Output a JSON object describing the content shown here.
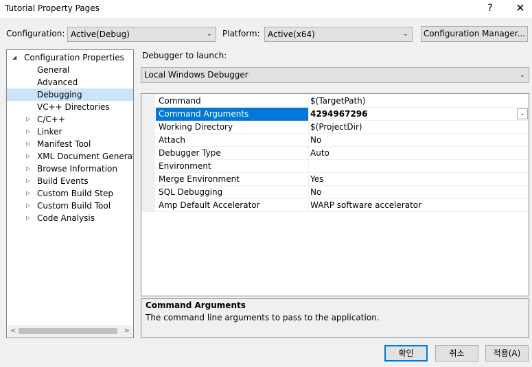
{
  "window": {
    "title": "Tutorial Property Pages",
    "help_glyph": "?",
    "close_glyph": "✕"
  },
  "toolbar": {
    "configuration_label": "Configuration:",
    "configuration_value": "Active(Debug)",
    "platform_label": "Platform:",
    "platform_value": "Active(x64)",
    "config_manager_label": "Configuration Manager..."
  },
  "tree": {
    "root": "Configuration Properties",
    "items": [
      {
        "label": "General",
        "expandable": false
      },
      {
        "label": "Advanced",
        "expandable": false
      },
      {
        "label": "Debugging",
        "expandable": false,
        "selected": true
      },
      {
        "label": "VC++ Directories",
        "expandable": false
      },
      {
        "label": "C/C++",
        "expandable": true
      },
      {
        "label": "Linker",
        "expandable": true
      },
      {
        "label": "Manifest Tool",
        "expandable": true
      },
      {
        "label": "XML Document Generator",
        "expandable": true
      },
      {
        "label": "Browse Information",
        "expandable": true
      },
      {
        "label": "Build Events",
        "expandable": true
      },
      {
        "label": "Custom Build Step",
        "expandable": true
      },
      {
        "label": "Custom Build Tool",
        "expandable": true
      },
      {
        "label": "Code Analysis",
        "expandable": true
      }
    ]
  },
  "debugger": {
    "launch_label": "Debugger to launch:",
    "launch_value": "Local Windows Debugger"
  },
  "properties": [
    {
      "name": "Command",
      "value": "$(TargetPath)"
    },
    {
      "name": "Command Arguments",
      "value": "4294967296",
      "selected": true
    },
    {
      "name": "Working Directory",
      "value": "$(ProjectDir)"
    },
    {
      "name": "Attach",
      "value": "No"
    },
    {
      "name": "Debugger Type",
      "value": "Auto"
    },
    {
      "name": "Environment",
      "value": ""
    },
    {
      "name": "Merge Environment",
      "value": "Yes"
    },
    {
      "name": "SQL Debugging",
      "value": "No"
    },
    {
      "name": "Amp Default Accelerator",
      "value": "WARP software accelerator"
    }
  ],
  "description": {
    "title": "Command Arguments",
    "text": "The command line arguments to pass to the application."
  },
  "buttons": {
    "ok": "확인",
    "cancel": "취소",
    "apply": "적용(A)"
  },
  "colors": {
    "selection": "#0078d7",
    "tree_selection": "#cce4f7"
  }
}
